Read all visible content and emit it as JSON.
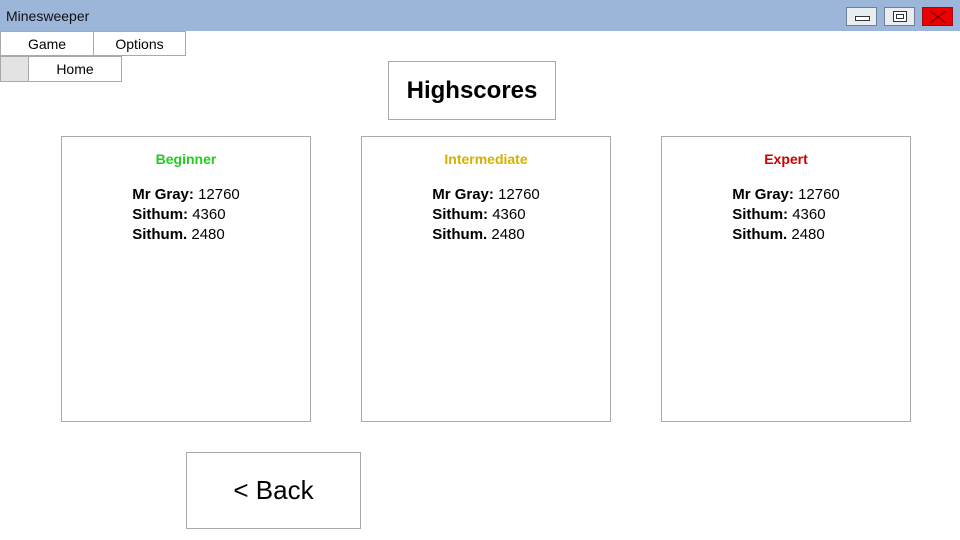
{
  "window": {
    "title": "Minesweeper",
    "close_color": "#ee0000",
    "titlebar_color": "#9cb6d9"
  },
  "menu": {
    "items": [
      {
        "label": "Game"
      },
      {
        "label": "Options"
      }
    ]
  },
  "tabs": {
    "home_label": "Home"
  },
  "page": {
    "title": "Highscores",
    "back_label": "< Back"
  },
  "highscores": [
    {
      "level": "Beginner",
      "color": "#22cc22",
      "entries": [
        {
          "name": "Mr Gray:",
          "score": "12760"
        },
        {
          "name": "Sithum:",
          "score": "4360"
        },
        {
          "name": "Sithum.",
          "score": "2480"
        }
      ]
    },
    {
      "level": "Intermediate",
      "color": "#d6b000",
      "entries": [
        {
          "name": "Mr Gray:",
          "score": "12760"
        },
        {
          "name": "Sithum:",
          "score": "4360"
        },
        {
          "name": "Sithum.",
          "score": "2480"
        }
      ]
    },
    {
      "level": "Expert",
      "color": "#cc0000",
      "entries": [
        {
          "name": "Mr Gray:",
          "score": "12760"
        },
        {
          "name": "Sithum:",
          "score": "4360"
        },
        {
          "name": "Sithum.",
          "score": "2480"
        }
      ]
    }
  ]
}
